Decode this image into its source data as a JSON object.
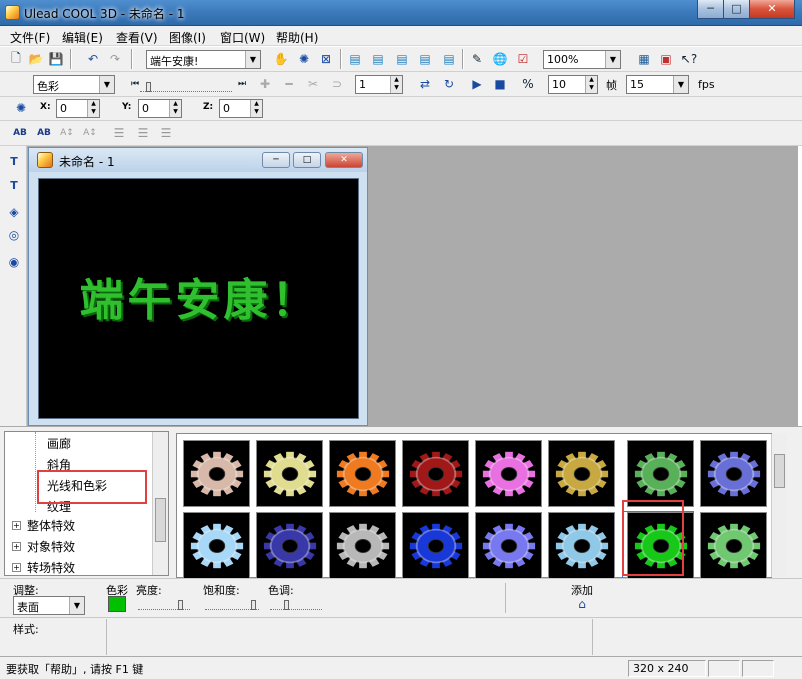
{
  "window": {
    "title": "Ulead COOL 3D - 未命名 - 1",
    "minimize_glyph": "─",
    "maximize_glyph": "□",
    "close_glyph": "✕"
  },
  "menu": [
    "文件(F)",
    "编辑(E)",
    "查看(V)",
    "图像(I)",
    "窗口(W)",
    "帮助(H)"
  ],
  "toolbar1": {
    "text_combo": "端午安康!",
    "zoom_combo": "100%"
  },
  "toolbar2": {
    "attribute_combo": "色彩",
    "frame_value": "1",
    "total_frames": "10",
    "frame_label": "帧",
    "fps_value": "15",
    "fps_label": "fps"
  },
  "toolbar3": {
    "x_label": "X:",
    "x_value": "0",
    "y_label": "Y:",
    "y_value": "0",
    "z_label": "Z:",
    "z_value": "0"
  },
  "document": {
    "title": "未命名 - 1",
    "canvas_text": "端午安康！",
    "text_color": "#2fbf2f"
  },
  "tree": {
    "items": [
      {
        "label": "画廊",
        "expandable": false
      },
      {
        "label": "斜角",
        "expandable": false
      },
      {
        "label": "光线和色彩",
        "expandable": false,
        "selected": true
      },
      {
        "label": "纹理",
        "expandable": false
      },
      {
        "label": "整体特效",
        "expandable": true
      },
      {
        "label": "对象特效",
        "expandable": true
      },
      {
        "label": "转场特效",
        "expandable": true
      }
    ]
  },
  "gallery": {
    "row1": [
      "#d8b8a8",
      "#e0dc90",
      "#f07a20",
      "#a01818",
      "#e870e0",
      "#c8a840",
      "#58b058",
      "#6870d8"
    ],
    "row2": [
      "#a8d8f8",
      "#3838a8",
      "#b8b8b8",
      "#1838d8",
      "#7878f0",
      "#90c8e8",
      "#18c818",
      "#70c870"
    ],
    "selected_index": 14
  },
  "props": {
    "adjust_label": "调整:",
    "adjust_value": "表面",
    "color_label": "色彩",
    "color_swatch": "#00c000",
    "brightness_label": "亮度:",
    "saturation_label": "饱和度:",
    "hue_label": "色调:",
    "add_label": "添加",
    "style_label": "样式:"
  },
  "status": {
    "help_text": "要获取「帮助」, 请按 F1 键",
    "resolution": "320 x 240"
  },
  "accent": "#e04040"
}
